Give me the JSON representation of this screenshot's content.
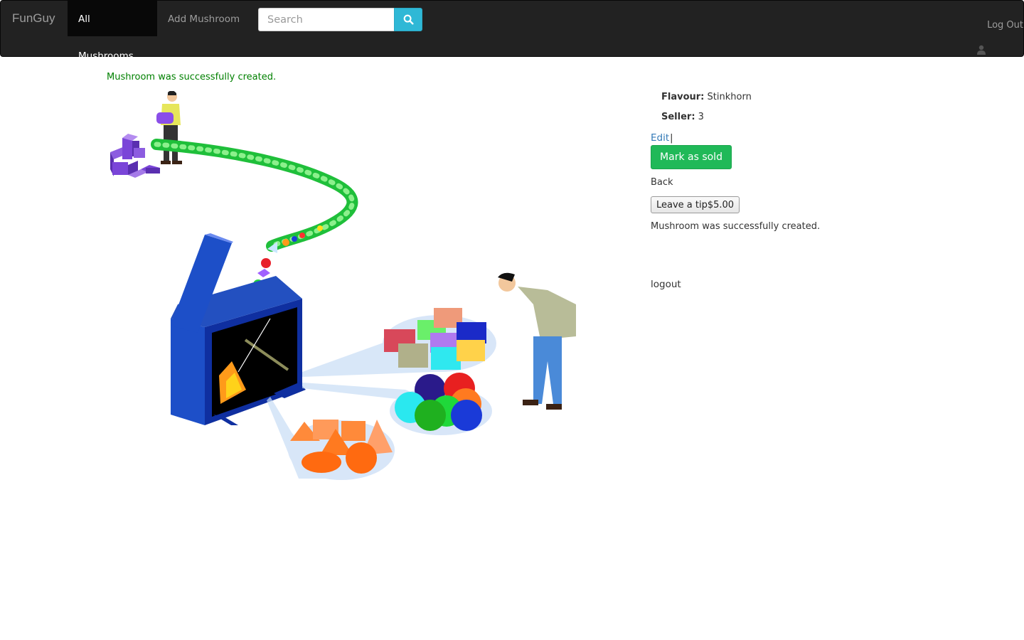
{
  "navbar": {
    "brand": "FunGuy",
    "items": [
      {
        "label": "All Mushrooms",
        "active": true
      },
      {
        "label": "Add Mushroom",
        "active": false
      }
    ],
    "search_placeholder": "Search",
    "search_icon": "search-icon",
    "logout_label": "Log Out",
    "user_icon": "user-icon"
  },
  "notice": "Mushroom was successfully created.",
  "details": {
    "flavour_label": "Flavour:",
    "flavour_value": "Stinkhorn",
    "seller_label": "Seller:",
    "seller_value": "3"
  },
  "actions": {
    "edit_label": "Edit",
    "separator": "|",
    "mark_sold_label": "Mark as sold",
    "back_label": "Back",
    "tip_label": "Leave a tip$5.00"
  },
  "notice_secondary": "Mushroom was successfully created.",
  "footer_logout": "logout",
  "colors": {
    "navbar_bg": "#222222",
    "search_button": "#2fb8d6",
    "success_button": "#20b958",
    "notice_green": "#008000",
    "link_blue": "#337ab7"
  }
}
